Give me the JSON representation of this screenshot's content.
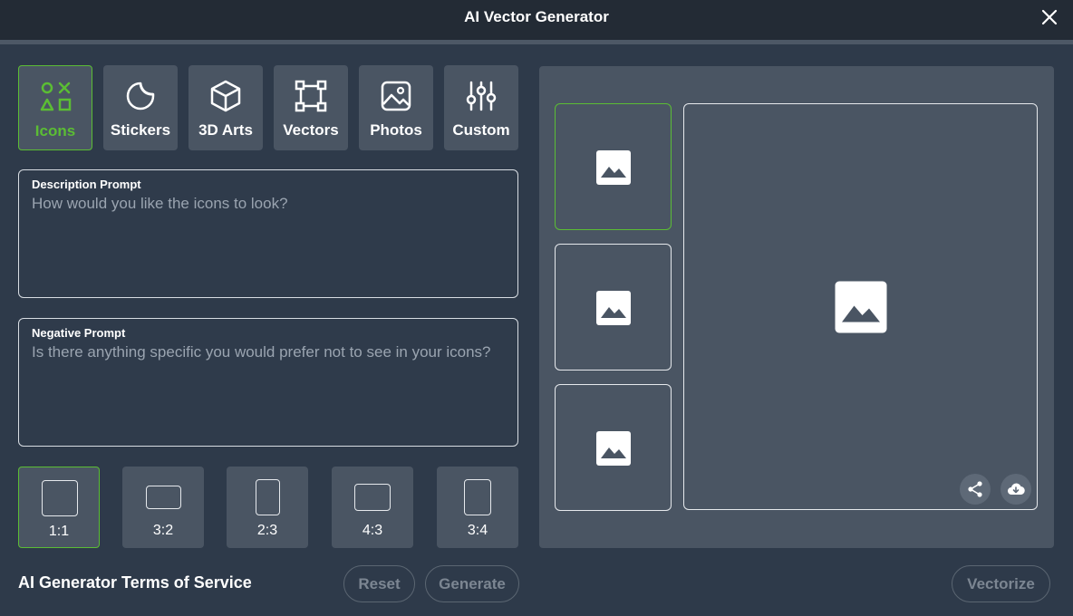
{
  "window": {
    "title": "AI Vector Generator"
  },
  "types": [
    {
      "label": "Icons",
      "icon": "shapes-icon",
      "active": true
    },
    {
      "label": "Stickers",
      "icon": "sticker-icon"
    },
    {
      "label": "3D Arts",
      "icon": "cube-icon"
    },
    {
      "label": "Vectors",
      "icon": "vector-path-icon"
    },
    {
      "label": "Photos",
      "icon": "photo-icon"
    },
    {
      "label": "Custom",
      "icon": "sliders-icon"
    }
  ],
  "description": {
    "label": "Description Prompt",
    "value": "",
    "placeholder": "How would you like the icons to look?"
  },
  "negative": {
    "label": "Negative Prompt",
    "value": "",
    "placeholder": "Is there anything specific you would prefer not to see in your icons?"
  },
  "ratios": [
    {
      "label": "1:1",
      "active": true
    },
    {
      "label": "3:2"
    },
    {
      "label": "2:3"
    },
    {
      "label": "4:3"
    },
    {
      "label": "3:4"
    }
  ],
  "footer": {
    "tos": "AI Generator Terms of Service",
    "reset": "Reset",
    "generate": "Generate",
    "vectorize": "Vectorize"
  },
  "preview": {
    "thumbnails": [
      "image-placeholder-icon",
      "image-placeholder-icon",
      "image-placeholder-icon"
    ],
    "selected_thumbnail": 0,
    "actions": [
      "share-icon",
      "cloud-download-icon"
    ]
  },
  "colors": {
    "accent": "#5bbd34",
    "background": "#2e3a4a",
    "panel": "#4a5563",
    "titlebar": "#232b35"
  }
}
